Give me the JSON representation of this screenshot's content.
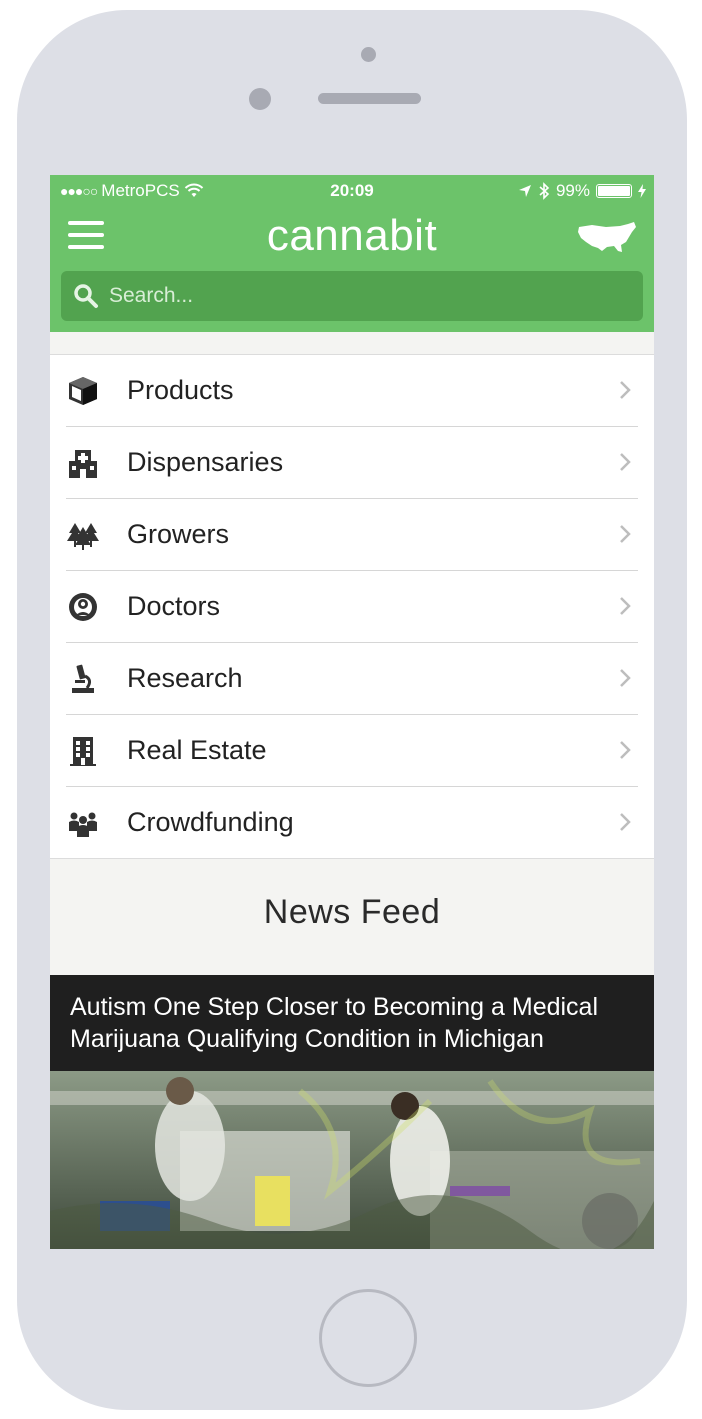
{
  "status_bar": {
    "signal_dots": "●●●○○",
    "carrier": "MetroPCS",
    "time": "20:09",
    "battery_percent": "99%",
    "battery_level": 0.99
  },
  "header": {
    "app_title": "cannabit",
    "menu_icon": "hamburger-icon",
    "map_icon": "usa-map-icon"
  },
  "search": {
    "placeholder": "Search..."
  },
  "menu": {
    "items": [
      {
        "label": "Products",
        "icon": "box-icon"
      },
      {
        "label": "Dispensaries",
        "icon": "medical-building-icon"
      },
      {
        "label": "Growers",
        "icon": "trees-icon"
      },
      {
        "label": "Doctors",
        "icon": "doctor-icon"
      },
      {
        "label": "Research",
        "icon": "microscope-icon"
      },
      {
        "label": "Real Estate",
        "icon": "building-icon"
      },
      {
        "label": "Crowdfunding",
        "icon": "people-group-icon"
      }
    ]
  },
  "news_feed": {
    "title": "News Feed",
    "articles": [
      {
        "headline": "Autism One Step Closer to Becoming a Medical Marijuana Qualifying Condition in Michigan"
      }
    ]
  },
  "colors": {
    "brand_green": "#6cc36a",
    "search_green": "#52a34f",
    "phone_body": "#dddfe6"
  }
}
